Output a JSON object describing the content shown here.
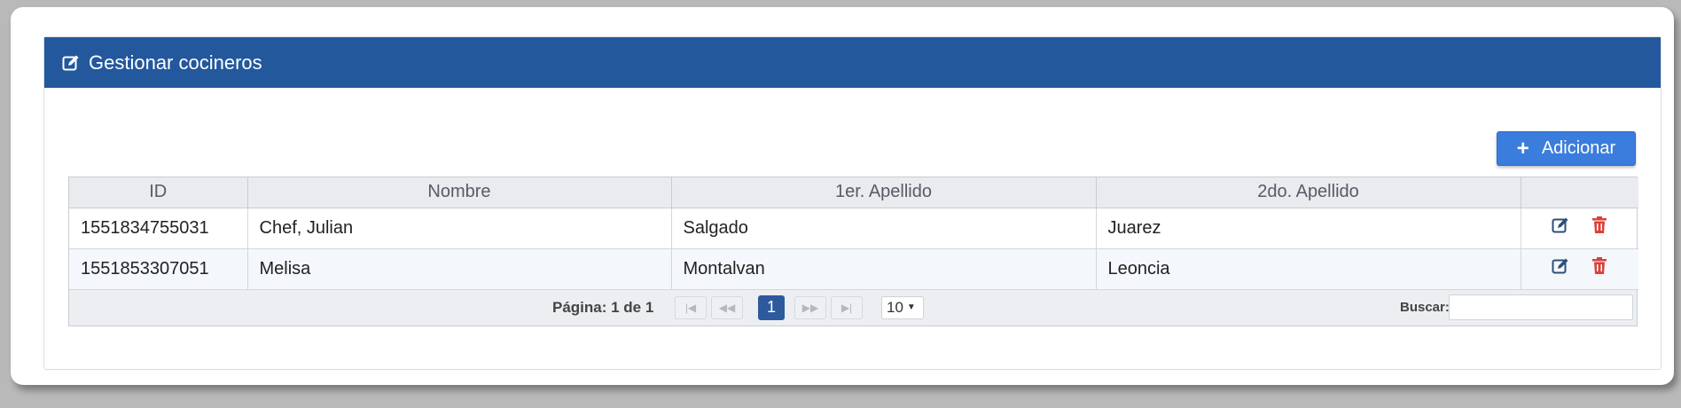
{
  "panel": {
    "title": "Gestionar cocineros",
    "header_icon": "edit-square-icon",
    "header_color": "#23589d"
  },
  "toolbar": {
    "add_label": "Adicionar",
    "add_icon": "plus-icon",
    "add_color": "#3b7ddd"
  },
  "table": {
    "columns": [
      "ID",
      "Nombre",
      "1er. Apellido",
      "2do. Apellido",
      ""
    ],
    "rows": [
      {
        "id": "1551834755031",
        "nombre": "Chef, Julian",
        "apellido1": "Salgado",
        "apellido2": "Juarez"
      },
      {
        "id": "1551853307051",
        "nombre": "Melisa",
        "apellido1": "Montalvan",
        "apellido2": "Leoncia"
      }
    ],
    "row_actions": {
      "edit_icon": "edit-icon",
      "delete_icon": "trash-icon",
      "edit_color": "#2c4f7c",
      "delete_color": "#d9413a"
    }
  },
  "pager": {
    "page_info": "Página: 1 de 1",
    "current_page": "1",
    "rows_per_page": "10",
    "search_label": "Buscar:",
    "search_value": ""
  }
}
